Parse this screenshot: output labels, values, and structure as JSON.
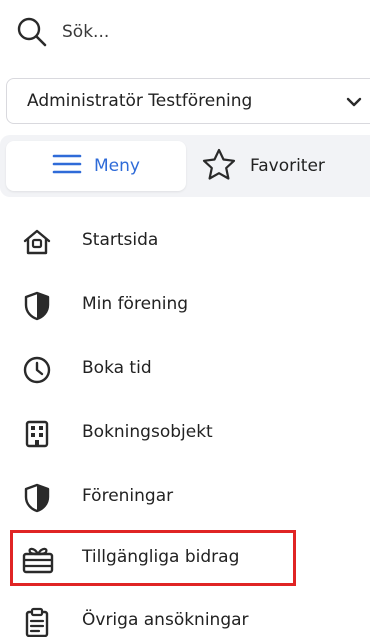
{
  "search": {
    "placeholder": "Sök...",
    "icon": "search-icon"
  },
  "role_select": {
    "value": "Administratör Testförening",
    "icon": "chevron-down-icon"
  },
  "tabs": {
    "menu_label": "Meny",
    "favorites_label": "Favoriter",
    "menu_icon": "hamburger-icon",
    "favorites_icon": "star-icon",
    "active": "Meny"
  },
  "menu": {
    "items": [
      {
        "label": "Startsida",
        "icon": "home-icon"
      },
      {
        "label": "Min förening",
        "icon": "shield-icon"
      },
      {
        "label": "Boka tid",
        "icon": "clock-icon"
      },
      {
        "label": "Bokningsobjekt",
        "icon": "building-icon"
      },
      {
        "label": "Föreningar",
        "icon": "shield-icon"
      },
      {
        "label": "Tillgängliga bidrag",
        "icon": "gift-icon",
        "highlighted": true
      },
      {
        "label": "Övriga ansökningar",
        "icon": "clipboard-icon"
      }
    ]
  },
  "colors": {
    "accent": "#2f6bd8",
    "highlight": "#e02424",
    "tab_background": "#f2f3f6"
  }
}
